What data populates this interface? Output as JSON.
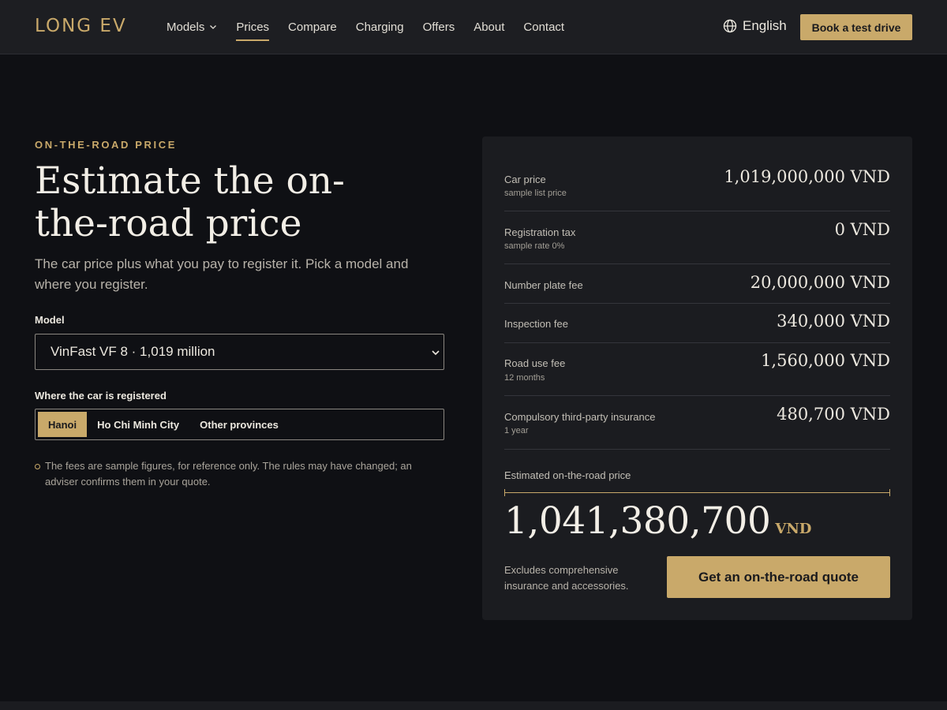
{
  "nav": {
    "logo": "LONG EV",
    "links": [
      {
        "label": "Models",
        "has_dropdown": true
      },
      {
        "label": "Prices",
        "active": true
      },
      {
        "label": "Compare"
      },
      {
        "label": "Charging"
      },
      {
        "label": "Offers"
      },
      {
        "label": "About"
      },
      {
        "label": "Contact"
      }
    ],
    "language": "English",
    "cta": "Book a test drive"
  },
  "hero": {
    "eyebrow": "ON-THE-ROAD PRICE",
    "title_line1": "Estimate the on-",
    "title_line2": "the-road price",
    "lede": "The car price plus what you pay to register it. Pick a model and where you register."
  },
  "form": {
    "model_label": "Model",
    "model_value": "VinFast VF 8 · 1,019 million",
    "region_label": "Where the car is registered",
    "regions": [
      "Hanoi",
      "Ho Chi Minh City",
      "Other provinces"
    ],
    "region_selected": "Hanoi",
    "note": "The fees are sample figures, for reference only. The rules may have changed; an adviser confirms them in your quote."
  },
  "breakdown": {
    "rows": [
      {
        "label": "Car price",
        "sub": "sample list price",
        "value": "1,019,000,000 VND"
      },
      {
        "label": "Registration tax",
        "sub": "sample rate 0%",
        "value": "0 VND"
      },
      {
        "label": "Number plate fee",
        "sub": "",
        "value": "20,000,000 VND"
      },
      {
        "label": "Inspection fee",
        "sub": "",
        "value": "340,000 VND"
      },
      {
        "label": "Road use fee",
        "sub": "12 months",
        "value": "1,560,000 VND"
      },
      {
        "label": "Compulsory third-party insurance",
        "sub": "1 year",
        "value": "480,700 VND"
      }
    ],
    "total_label": "Estimated on-the-road price",
    "total_value": "1,041,380,700",
    "total_currency": "VND",
    "exclusion": "Excludes comprehensive insurance and accessories.",
    "cta": "Get an on-the-road quote"
  },
  "colors": {
    "accent": "#c9a96a",
    "background": "#0f1014",
    "card": "#1b1c20"
  }
}
